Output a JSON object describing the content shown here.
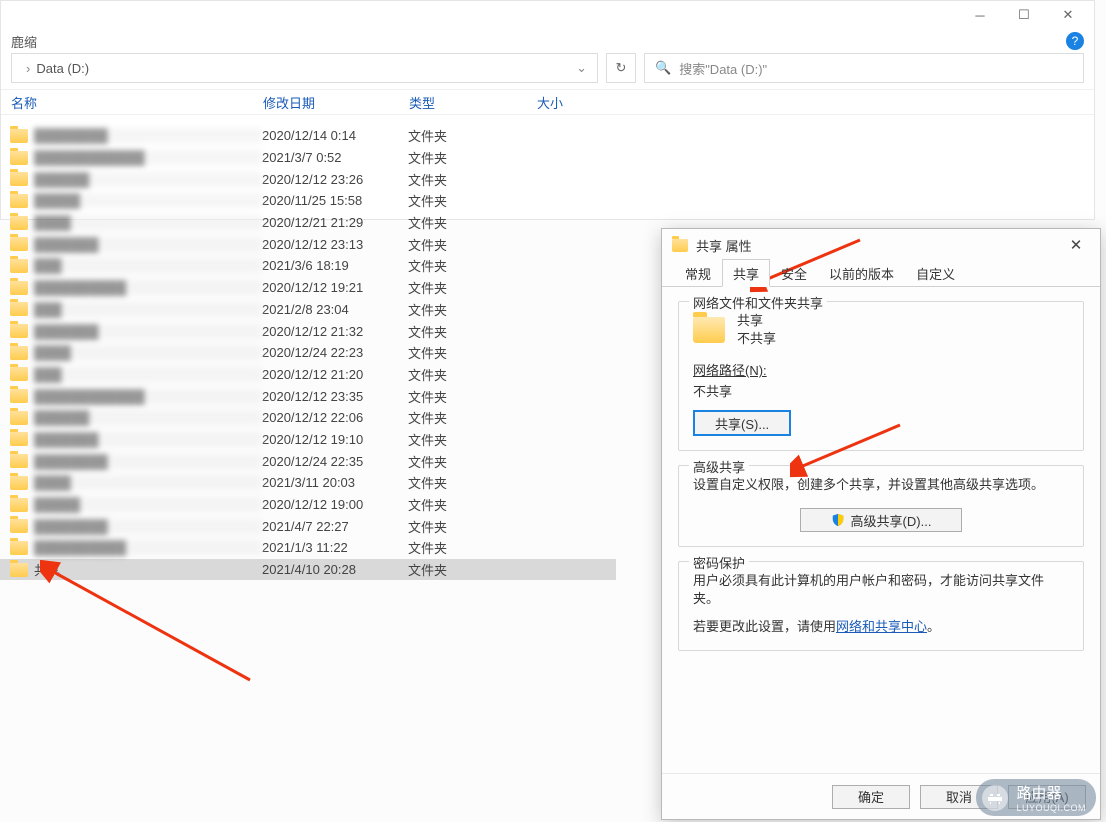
{
  "explorer": {
    "ribbon_label": "鹿缩",
    "address": "Data (D:)",
    "refresh": "↻",
    "search_placeholder": "搜索\"Data (D:)\"",
    "columns": {
      "name": "名称",
      "date": "修改日期",
      "type": "类型",
      "size": "大小"
    },
    "rows": [
      {
        "name": "████████",
        "date": "2020/12/14 0:14",
        "type": "文件夹",
        "blur": true
      },
      {
        "name": "████████████",
        "date": "2021/3/7 0:52",
        "type": "文件夹",
        "blur": true
      },
      {
        "name": "██████",
        "date": "2020/12/12 23:26",
        "type": "文件夹",
        "blur": true
      },
      {
        "name": "█████",
        "date": "2020/11/25 15:58",
        "type": "文件夹",
        "blur": true
      },
      {
        "name": "████",
        "date": "2020/12/21 21:29",
        "type": "文件夹",
        "blur": true
      },
      {
        "name": "███████",
        "date": "2020/12/12 23:13",
        "type": "文件夹",
        "blur": true
      },
      {
        "name": "███",
        "date": "2021/3/6 18:19",
        "type": "文件夹",
        "blur": true
      },
      {
        "name": "██████████",
        "date": "2020/12/12 19:21",
        "type": "文件夹",
        "blur": true
      },
      {
        "name": "███",
        "date": "2021/2/8 23:04",
        "type": "文件夹",
        "blur": true
      },
      {
        "name": "███████",
        "date": "2020/12/12 21:32",
        "type": "文件夹",
        "blur": true
      },
      {
        "name": "████",
        "date": "2020/12/24 22:23",
        "type": "文件夹",
        "blur": true
      },
      {
        "name": "███",
        "date": "2020/12/12 21:20",
        "type": "文件夹",
        "blur": true
      },
      {
        "name": "████████████",
        "date": "2020/12/12 23:35",
        "type": "文件夹",
        "blur": true
      },
      {
        "name": "██████",
        "date": "2020/12/12 22:06",
        "type": "文件夹",
        "blur": true
      },
      {
        "name": "███████",
        "date": "2020/12/12 19:10",
        "type": "文件夹",
        "blur": true
      },
      {
        "name": "████████",
        "date": "2020/12/24 22:35",
        "type": "文件夹",
        "blur": true
      },
      {
        "name": "████",
        "date": "2021/3/11 20:03",
        "type": "文件夹",
        "blur": true
      },
      {
        "name": "█████",
        "date": "2020/12/12 19:00",
        "type": "文件夹",
        "blur": true
      },
      {
        "name": "████████",
        "date": "2021/4/7 22:27",
        "type": "文件夹",
        "blur": true
      },
      {
        "name": "██████████",
        "date": "2021/1/3 11:22",
        "type": "文件夹",
        "blur": true
      },
      {
        "name": "共享",
        "date": "2021/4/10 20:28",
        "type": "文件夹",
        "blur": false,
        "selected": true
      }
    ]
  },
  "dialog": {
    "title": "共享 属性",
    "tabs": {
      "general": "常规",
      "sharing": "共享",
      "security": "安全",
      "previous": "以前的版本",
      "custom": "自定义"
    },
    "group1": {
      "title": "网络文件和文件夹共享",
      "line1": "共享",
      "line2": "不共享",
      "path_label": "网络路径(N):",
      "path_value": "不共享",
      "share_btn": "共享(S)..."
    },
    "group2": {
      "title": "高级共享",
      "desc": "设置自定义权限，创建多个共享，并设置其他高级共享选项。",
      "btn": "高级共享(D)..."
    },
    "group3": {
      "title": "密码保护",
      "line1": "用户必须具有此计算机的用户帐户和密码，才能访问共享文件夹。",
      "line2a": "若要更改此设置，请使用",
      "link": "网络和共享中心",
      "line2b": "。"
    },
    "buttons": {
      "ok": "确定",
      "cancel": "取消",
      "apply": "应用(A)"
    }
  },
  "watermark": {
    "text": "路由器",
    "sub": "LUYOUQI.COM"
  }
}
